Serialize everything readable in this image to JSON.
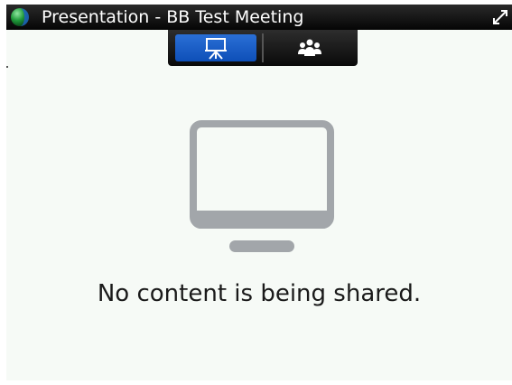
{
  "window": {
    "title": "Presentation - BB Test Meeting"
  },
  "tabs": [
    {
      "name": "presentation",
      "icon": "presentation-icon",
      "selected": true
    },
    {
      "name": "participants",
      "icon": "participants-icon",
      "selected": false
    }
  ],
  "content": {
    "message": "No content is being shared.",
    "illustration": "monitor-icon"
  },
  "colors": {
    "accent": "#1e5fc8",
    "titlebar": "#111111",
    "background": "#f6faf6",
    "illustration": "#a2a6aa"
  }
}
